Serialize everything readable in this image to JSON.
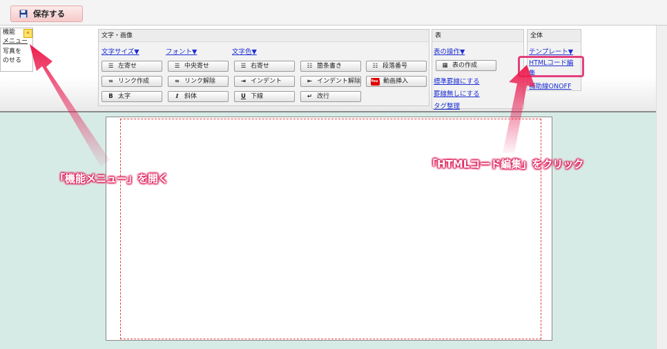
{
  "toolbar": {
    "save_label": "保存する"
  },
  "side_menu": {
    "line1": "機能",
    "collapse_glyph": "«",
    "line2": "メニュー",
    "line3": "写真を",
    "line4": "のせる"
  },
  "text_panel": {
    "title": "文字・画像",
    "dropdowns": [
      "文字サイズ▼",
      "フォント▼",
      "文字色▼"
    ],
    "buttons": [
      "左寄せ",
      "中央寄せ",
      "右寄せ",
      "箇条書き",
      "段落番号",
      "リンク作成",
      "リンク解除",
      "インデント",
      "インデント解除",
      "動画挿入",
      "太字",
      "斜体",
      "下線",
      "改行"
    ],
    "youtube_badge": "You Tube"
  },
  "table_panel": {
    "title": "表",
    "ops_dropdown": "表の操作▼",
    "create_button": "表の作成",
    "standard_border": "標準罫線にする",
    "no_border": "罫線無しにする",
    "tag_cleanup": "タグ整理"
  },
  "all_panel": {
    "title": "全体",
    "template_dropdown": "テンプレート▼",
    "html_edit_line1": "HTMLコード編",
    "html_edit_line2": "集",
    "guideline_toggle": "補助線ONOFF"
  },
  "annotations": {
    "open_menu": "「機能メニュー」を開く",
    "click_html": "「HTMLコード編集」をクリック",
    "accent": "#e0245e"
  }
}
